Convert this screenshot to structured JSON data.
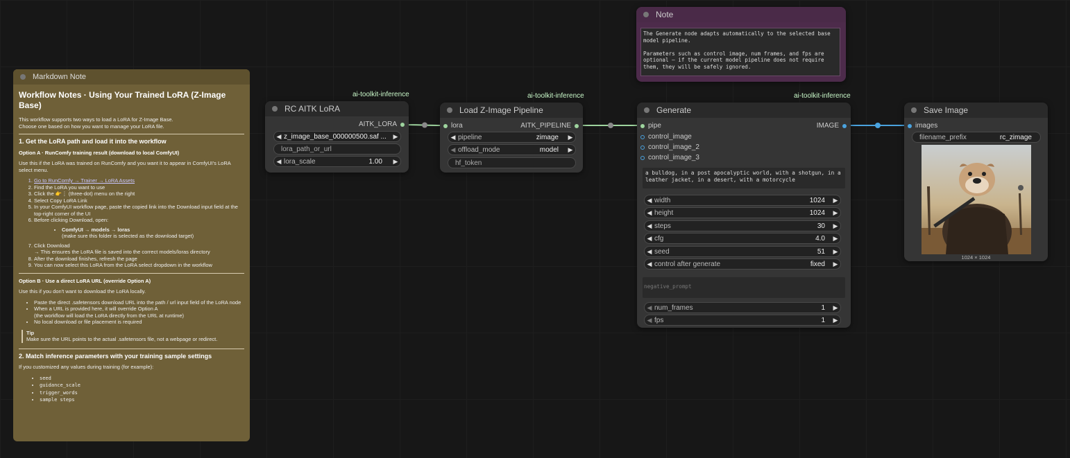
{
  "colors": {
    "accent_wire": "#4aa3df",
    "green_wire": "#9ed49e",
    "note_bg": "#4d2b4b",
    "markdown_bg": "#6f6038"
  },
  "markdown_note": {
    "title": "Markdown Note",
    "h1": "Workflow Notes · Using Your Trained LoRA (Z-Image Base)",
    "intro_1": "This workflow supports two ways to load a LoRA for Z-Image Base.",
    "intro_2": "Choose one based on how you want to manage your LoRA file.",
    "section1": "1. Get the LoRA path and load it into the workflow",
    "optA_heading": "Option A · RunComfy training result (download to local ComfyUI)",
    "optA_intro": "Use this if the LoRA was trained on RunComfy and you want it to appear in ComfyUI's LoRA select menu.",
    "optA_steps": [
      "Go to RunComfy → Trainer → LoRA Assets",
      "Find the LoRA you want to use",
      "Click the 👉⋮ (three-dot) menu on the right",
      "Select Copy LoRA Link",
      "In your ComfyUI workflow page, paste the copied link into the Download input field at the top-right corner of the UI",
      "Before clicking Download, open:"
    ],
    "optA_sub_1": "ComfyUI → models → loras",
    "optA_sub_2": "(make sure this folder is selected as the download target)",
    "optA_steps_b": [
      "Click Download",
      "After the download finishes, refresh the page",
      "You can now select this LoRA from the LoRA select dropdown in the workflow"
    ],
    "optA_arrow_note": "→ This ensures the LoRA file is saved into the correct models/loras directory",
    "optB_heading": "Option B · Use a direct LoRA URL (override Option A)",
    "optB_intro": "Use this if you don't want to download the LoRA locally.",
    "optB_bullets": [
      "Paste the direct .safetensors download URL into the path / url input field of the LoRA node",
      "When a URL is provided here, it will override Option A",
      "No local download or file placement is required"
    ],
    "optB_bullet_2_sub": "(the workflow will load the LoRA directly from the URL at runtime)",
    "tip_title": "Tip",
    "tip_text": "Make sure the URL points to the actual .safetensors file, not a webpage or redirect.",
    "section2": "2. Match inference parameters with your training sample settings",
    "section2_intro": "If you customized any values during training (for example):",
    "section2_items": [
      "seed",
      "guidance_scale",
      "trigger_words",
      "sample steps"
    ]
  },
  "lora_node": {
    "badge": "ai-toolkit-inference",
    "title": "RC AITK LoRA",
    "output": "AITK_LORA",
    "lora_file": "z_image_base_000000500.saf ...",
    "path_placeholder": "lora_path_or_url",
    "scale_label": "lora_scale",
    "scale_value": "1.00"
  },
  "pipeline_node": {
    "badge": "ai-toolkit-inference",
    "title": "Load Z-Image Pipeline",
    "input": "lora",
    "output": "AITK_PIPELINE",
    "pipeline_label": "pipeline",
    "pipeline_value": "zimage",
    "offload_label": "offload_mode",
    "offload_value": "model",
    "hf_token": "hf_token"
  },
  "note": {
    "title": "Note",
    "text": "The Generate node adapts automatically to the selected base model pipeline.\n\nParameters such as control image, num frames, and fps are optional — if the current model pipeline does not require them, they will be safely ignored."
  },
  "generate_node": {
    "badge": "ai-toolkit-inference",
    "title": "Generate",
    "inputs": [
      "pipe",
      "control_image",
      "control_image_2",
      "control_image_3"
    ],
    "output": "IMAGE",
    "prompt": "a bulldog, in a post apocalyptic world, with a shotgun, in a leather jacket, in a desert, with a motorcycle",
    "widgets": [
      {
        "label": "width",
        "value": "1024"
      },
      {
        "label": "height",
        "value": "1024"
      },
      {
        "label": "steps",
        "value": "30"
      },
      {
        "label": "cfg",
        "value": "4.0"
      },
      {
        "label": "seed",
        "value": "51"
      },
      {
        "label": "control after generate",
        "value": "fixed"
      }
    ],
    "negative_placeholder": "negative_prompt",
    "widgets_b": [
      {
        "label": "num_frames",
        "value": "1"
      },
      {
        "label": "fps",
        "value": "1"
      }
    ]
  },
  "save_node": {
    "title": "Save Image",
    "input": "images",
    "prefix_label": "filename_prefix",
    "prefix_value": "rc_zimage",
    "image_size": "1024 × 1024"
  }
}
